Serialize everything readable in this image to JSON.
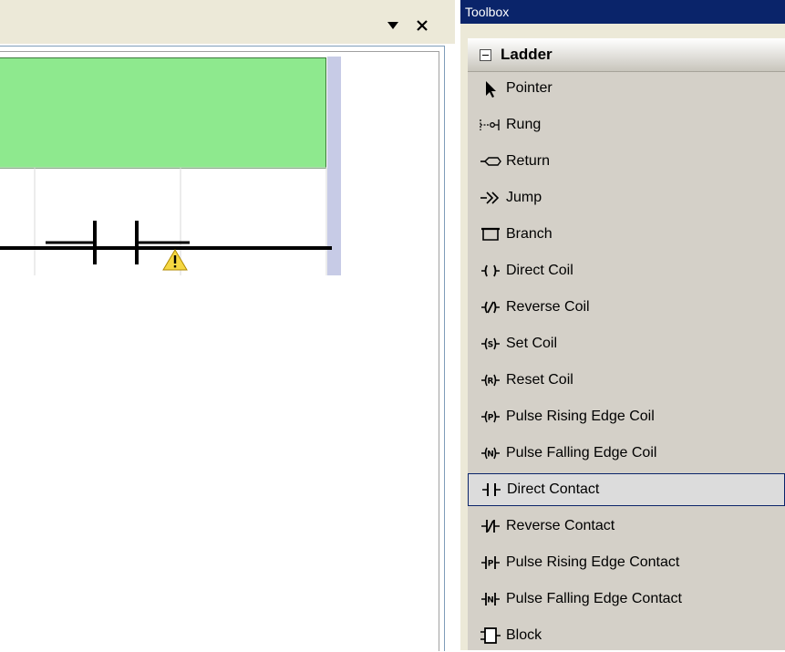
{
  "editor": {
    "dropdown_glyph": "▾",
    "close_glyph": "✕",
    "rung_color": "#8ee98e",
    "warning_icon": "warning-icon"
  },
  "toolbox": {
    "title": "Toolbox",
    "category": "Ladder",
    "selected_index": 11,
    "items": [
      {
        "label": "Pointer",
        "icon": "pointer-icon"
      },
      {
        "label": "Rung",
        "icon": "rung-icon"
      },
      {
        "label": "Return",
        "icon": "return-icon"
      },
      {
        "label": "Jump",
        "icon": "jump-icon"
      },
      {
        "label": "Branch",
        "icon": "branch-icon"
      },
      {
        "label": "Direct Coil",
        "icon": "direct-coil-icon"
      },
      {
        "label": "Reverse Coil",
        "icon": "reverse-coil-icon"
      },
      {
        "label": "Set Coil",
        "icon": "set-coil-icon"
      },
      {
        "label": "Reset Coil",
        "icon": "reset-coil-icon"
      },
      {
        "label": "Pulse Rising Edge Coil",
        "icon": "pulse-rising-edge-coil-icon"
      },
      {
        "label": "Pulse Falling Edge Coil",
        "icon": "pulse-falling-edge-coil-icon"
      },
      {
        "label": "Direct Contact",
        "icon": "direct-contact-icon"
      },
      {
        "label": "Reverse Contact",
        "icon": "reverse-contact-icon"
      },
      {
        "label": "Pulse Rising Edge Contact",
        "icon": "pulse-rising-edge-contact-icon"
      },
      {
        "label": "Pulse Falling Edge Contact",
        "icon": "pulse-falling-edge-contact-icon"
      },
      {
        "label": "Block",
        "icon": "block-icon"
      }
    ]
  }
}
